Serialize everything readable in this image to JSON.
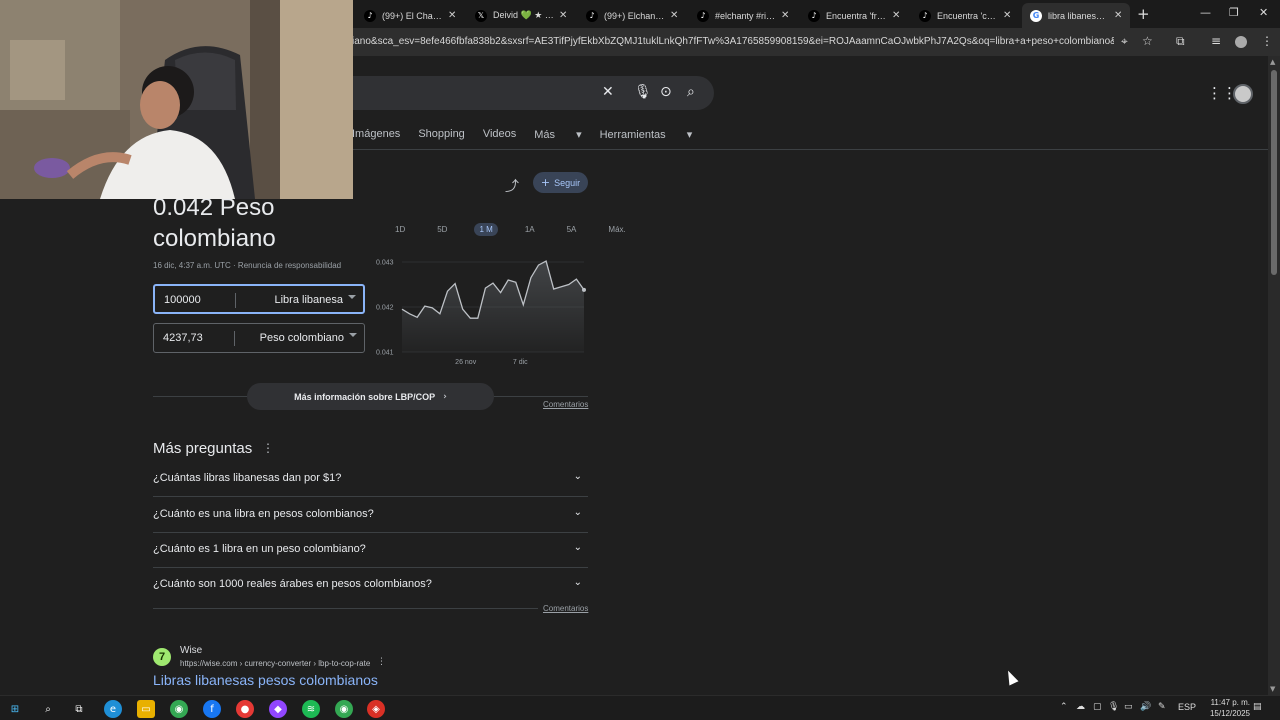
{
  "browser": {
    "tabs": [
      {
        "label": "(99+) El Chantyy (",
        "icon": "tiktok-icon"
      },
      {
        "label": "Deivid 💚 ★ en X",
        "icon": "x-icon"
      },
      {
        "label": "(99+) Elchantyy (@",
        "icon": "tiktok-icon"
      },
      {
        "label": "#elchanty #risa #",
        "icon": "tiktok-icon"
      },
      {
        "label": "Encuentra 'frezo'",
        "icon": "tiktok-icon"
      },
      {
        "label": "Encuentra 'chanty",
        "icon": "tiktok-icon"
      },
      {
        "label": "libra libanesa a p",
        "icon": "google-icon",
        "active": true
      }
    ],
    "url": "iano&sca_esv=8efe466fbfa838b2&sxsrf=AE3TifPjyfEkbXbZQMJ1tuklLnkQh7fFTw%3A1765859908159&ei=ROJAaamnCaOJwbkPhJ7A2Qs&oq=libra+a+peso+colombiano&gs_lp=Egxn..."
  },
  "search": {
    "filters": [
      "Imágenes",
      "Shopping",
      "Videos",
      "Más",
      "Herramientas"
    ]
  },
  "converter": {
    "follow_label": "Seguir",
    "result_line1": "0.042 Peso",
    "result_line2": "colombiano",
    "timestamp": "16 dic, 4:37 a.m. UTC · Renuncia de responsabilidad",
    "from_value": "100000",
    "from_currency": "Libra libanesa",
    "to_value": "4237,73",
    "to_currency": "Peso colombiano",
    "ranges": [
      "1D",
      "5D",
      "1 M",
      "1A",
      "5A",
      "Máx."
    ],
    "selected_range": "1 M",
    "more_info": "Más información sobre LBP/COP",
    "feedback": "Comentarios"
  },
  "chart_data": {
    "type": "line",
    "x_tick_labels": [
      "26 nov",
      "7 dic"
    ],
    "y_tick_labels": [
      "0.043",
      "0.042",
      "0.041"
    ],
    "ylim": [
      0.041,
      0.043
    ],
    "series": [
      {
        "values": [
          0.04195,
          0.04185,
          0.04177,
          0.04202,
          0.04198,
          0.04185,
          0.04235,
          0.04252,
          0.04195,
          0.04175,
          0.04175,
          0.04242,
          0.04253,
          0.04232,
          0.0426,
          0.04255,
          0.04205,
          0.04265,
          0.04293,
          0.04302,
          0.0424,
          0.04245,
          0.0425,
          0.04262,
          0.04238
        ]
      }
    ]
  },
  "people_also_ask": {
    "title": "Más preguntas",
    "questions": [
      "¿Cuántas libras libanesas dan por $1?",
      "¿Cuánto es una libra en pesos colombianos?",
      "¿Cuánto es 1 libra en un peso colombiano?",
      "¿Cuánto son 1000 reales árabes en pesos colombianos?"
    ],
    "feedback": "Comentarios"
  },
  "result": {
    "site_name": "Wise",
    "site_url": "https://wise.com › currency-converter › lbp-to-cop-rate",
    "title": "Libras libanesas pesos colombianos"
  },
  "taskbar": {
    "language": "ESP",
    "time": "11:47 p. m.",
    "date": "15/12/2025"
  }
}
